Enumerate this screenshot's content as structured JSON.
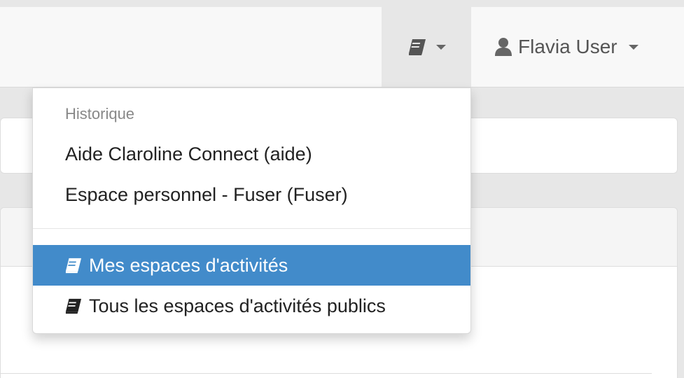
{
  "navbar": {
    "workspaces_icon": "book-icon",
    "user": {
      "icon": "user-icon",
      "name": "Flavia User"
    }
  },
  "dropdown": {
    "header": "Historique",
    "history_items": [
      {
        "label": "Aide Claroline Connect (aide)"
      },
      {
        "label": "Espace personnel - Fuser (Fuser)"
      }
    ],
    "workspace_items": [
      {
        "label": "Mes espaces d'activités",
        "icon": "book-icon",
        "active": true
      },
      {
        "label": "Tous les espaces d'activités publics",
        "icon": "book-icon",
        "active": false
      }
    ]
  },
  "colors": {
    "active_bg": "#428bca",
    "navbar_bg": "#f8f8f8",
    "page_bg": "#e7e7e7"
  }
}
